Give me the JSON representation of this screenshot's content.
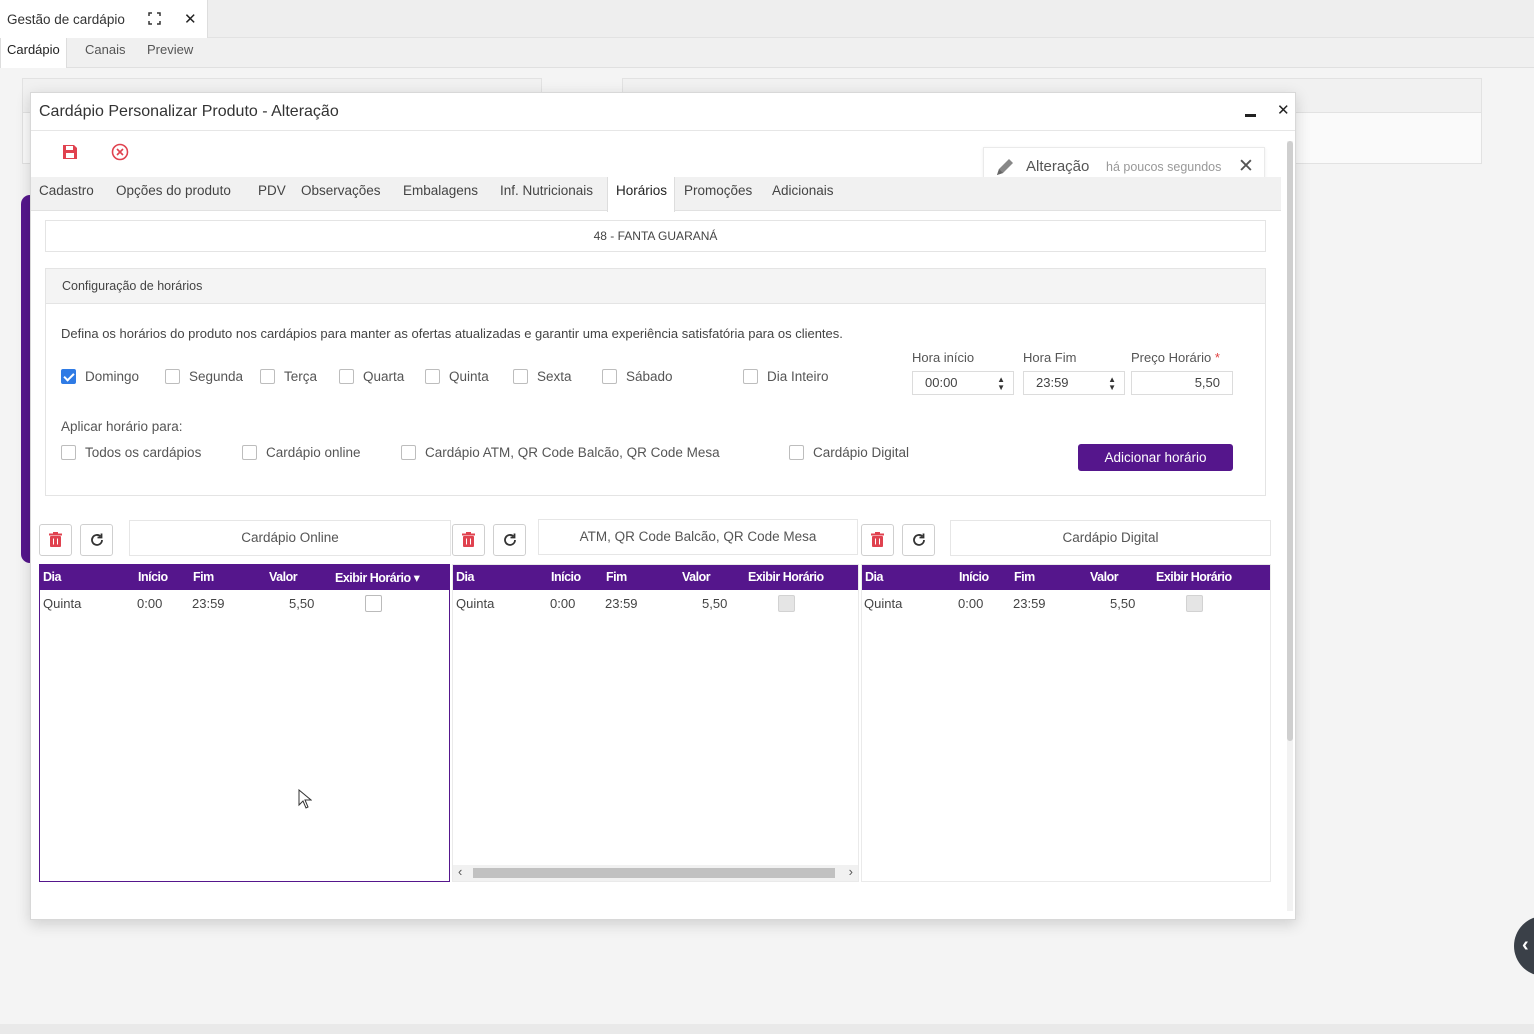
{
  "app": {
    "tab_title": "Gestão de cardápio",
    "subtabs": [
      "Cardápio",
      "Canais",
      "Preview"
    ]
  },
  "modal": {
    "title": "Cardápio Personalizar Produto - Alteração",
    "notification": {
      "title": "Alteração",
      "subtitle": "há poucos segundos"
    },
    "tabs": [
      "Cadastro",
      "Opções do produto",
      "PDV",
      "Observações",
      "Embalagens",
      "Inf. Nutricionais",
      "Horários",
      "Promoções",
      "Adicionais"
    ],
    "active_tab": "Horários",
    "product": "48 - FANTA GUARANÁ"
  },
  "config": {
    "header": "Configuração de horários",
    "description": "Defina os horários do produto nos cardápios para manter as ofertas atualizadas e garantir uma experiência satisfatória para os clientes.",
    "days": [
      {
        "label": "Domingo",
        "checked": true
      },
      {
        "label": "Segunda",
        "checked": false
      },
      {
        "label": "Terça",
        "checked": false
      },
      {
        "label": "Quarta",
        "checked": false
      },
      {
        "label": "Quinta",
        "checked": false
      },
      {
        "label": "Sexta",
        "checked": false
      },
      {
        "label": "Sábado",
        "checked": false
      },
      {
        "label": "Dia Inteiro",
        "checked": false
      }
    ],
    "hora_inicio": {
      "label": "Hora início",
      "value": "00:00"
    },
    "hora_fim": {
      "label": "Hora Fim",
      "value": "23:59"
    },
    "preco": {
      "label": "Preço Horário",
      "required_mark": "*",
      "value": "5,50"
    },
    "apply_label": "Aplicar horário para:",
    "targets": [
      "Todos os cardápios",
      "Cardápio online",
      "Cardápio ATM, QR Code Balcão, QR Code Mesa",
      "Cardápio Digital"
    ],
    "add_button": "Adicionar horário"
  },
  "sections": [
    {
      "title": "Cardápio Online",
      "columns": [
        "Dia",
        "Início",
        "Fim",
        "Valor",
        "Exibir Horário ▾"
      ],
      "rows": [
        {
          "dia": "Quinta",
          "inicio": "0:00",
          "fim": "23:59",
          "valor": "5,50",
          "exibir": false
        }
      ]
    },
    {
      "title": "ATM, QR Code Balcão, QR Code Mesa",
      "columns": [
        "Dia",
        "Início",
        "Fim",
        "Valor",
        "Exibir Horário"
      ],
      "rows": [
        {
          "dia": "Quinta",
          "inicio": "0:00",
          "fim": "23:59",
          "valor": "5,50",
          "exibir": false
        }
      ]
    },
    {
      "title": "Cardápio Digital",
      "columns": [
        "Dia",
        "Início",
        "Fim",
        "Valor",
        "Exibir Horário"
      ],
      "rows": [
        {
          "dia": "Quinta",
          "inicio": "0:00",
          "fim": "23:59",
          "valor": "5,50",
          "exibir": false
        }
      ]
    }
  ],
  "colors": {
    "primary": "#55168c",
    "check": "#2f7be5",
    "danger": "#e0424f"
  }
}
